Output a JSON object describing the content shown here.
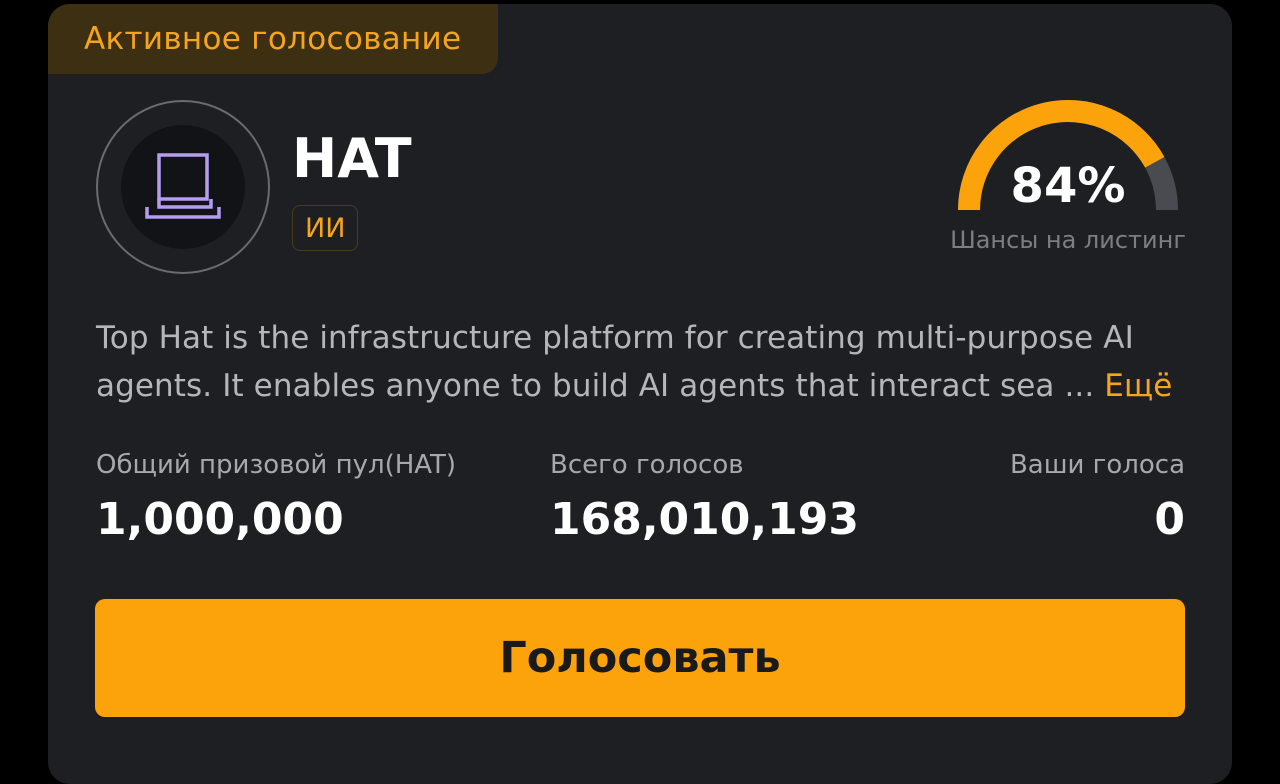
{
  "status_tag": "Активное голосование",
  "token": {
    "name": "HAT",
    "category": "ИИ",
    "logo_icon": "top-hat-laptop-icon",
    "logo_color": "#b59cf0"
  },
  "listing_chance": {
    "value_text": "84%",
    "value": 84,
    "label": "Шансы на листинг",
    "fill_color": "#fca30c",
    "track_color": "#4a4b50"
  },
  "description": {
    "line1": "Top Hat is the infrastructure platform for creating multi-purpose AI",
    "line2": "agents. It enables anyone to build AI agents that interact sea ... ",
    "more_label": "Ещё"
  },
  "stats": {
    "prize_pool_label": "Общий призовой пул(HAT)",
    "prize_pool_value": "1,000,000",
    "total_votes_label": "Всего голосов",
    "total_votes_value": "168,010,193",
    "your_votes_label": "Ваши голоса",
    "your_votes_value": "0"
  },
  "vote_button": "Голосовать",
  "colors": {
    "accent": "#f7a41d",
    "button": "#fca30c",
    "card_bg": "#1e1f23"
  }
}
